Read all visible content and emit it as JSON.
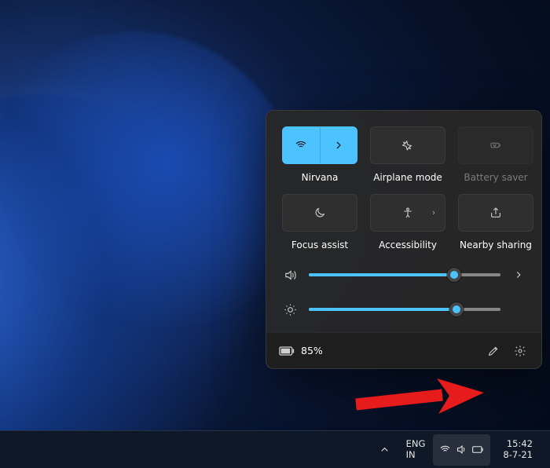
{
  "panel": {
    "tiles": [
      {
        "id": "wifi",
        "label": "Nirvana",
        "active": true,
        "split": true
      },
      {
        "id": "airplane",
        "label": "Airplane mode",
        "active": false
      },
      {
        "id": "battery-saver",
        "label": "Battery saver",
        "active": false,
        "disabled": true
      },
      {
        "id": "focus-assist",
        "label": "Focus assist",
        "active": false
      },
      {
        "id": "accessibility",
        "label": "Accessibility",
        "active": false,
        "has_chevron": true
      },
      {
        "id": "nearby-share",
        "label": "Nearby sharing",
        "active": false
      }
    ],
    "sliders": {
      "volume": {
        "value": 76
      },
      "brightness": {
        "value": 77
      }
    },
    "footer": {
      "battery_text": "85%"
    }
  },
  "taskbar": {
    "lang_top": "ENG",
    "lang_bottom": "IN",
    "time": "15:42",
    "date": "8-7-21"
  }
}
